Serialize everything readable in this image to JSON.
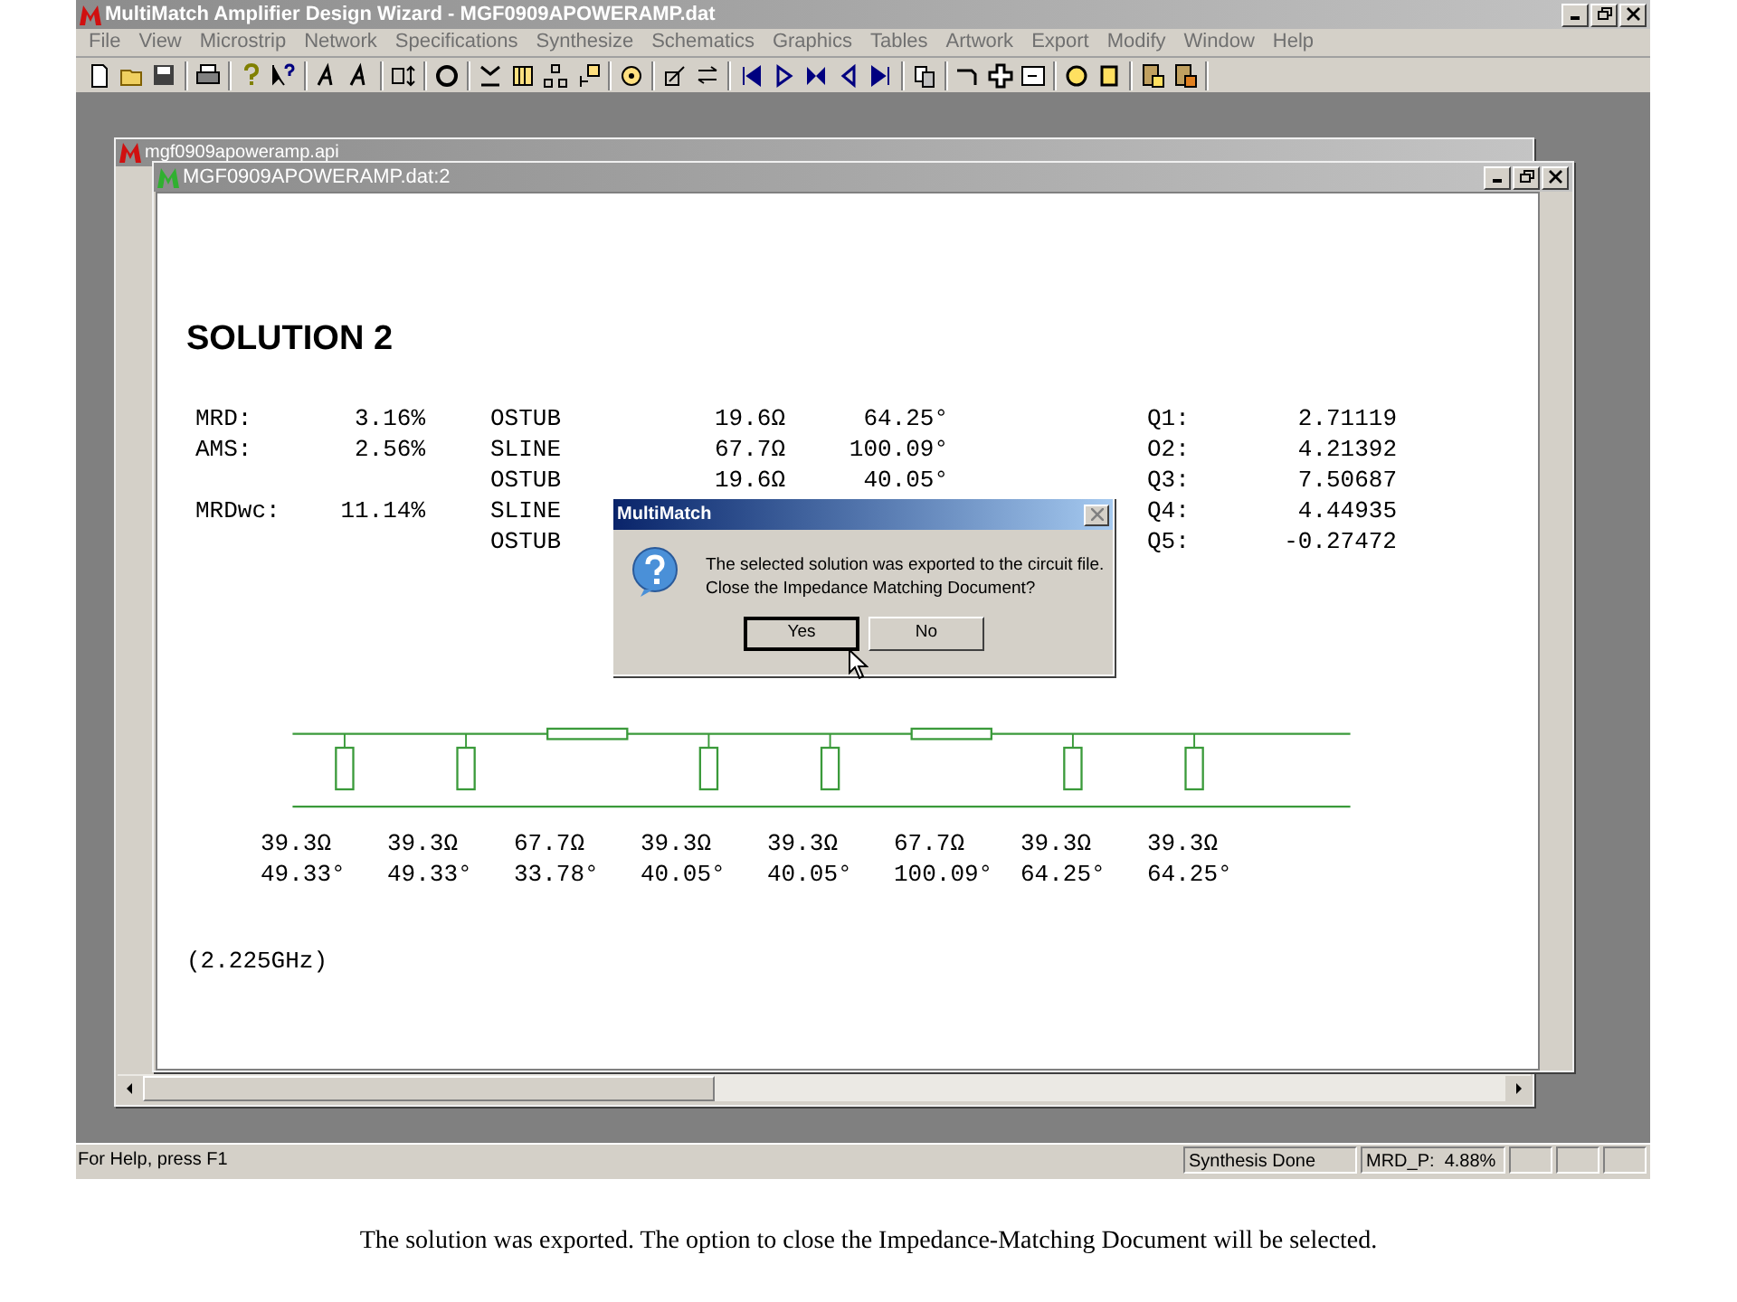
{
  "window": {
    "title": "MultiMatch Amplifier Design Wizard - MGF0909APOWERAMP.dat"
  },
  "menu": [
    "File",
    "View",
    "Microstrip",
    "Network",
    "Specifications",
    "Synthesize",
    "Schematics",
    "Graphics",
    "Tables",
    "Artwork",
    "Export",
    "Modify",
    "Window",
    "Help"
  ],
  "documents": [
    {
      "title": "mgf0909apoweramp.api"
    },
    {
      "title": "MGF0909APOWERAMP.dat:2"
    }
  ],
  "solution": {
    "heading": "SOLUTION 2",
    "rows": [
      {
        "metric": {
          "label": "MRD:",
          "value": "3.16%"
        },
        "element": {
          "type": "OSTUB",
          "impedance": "19.6Ω",
          "angle": "64.25°"
        },
        "q": {
          "label": "Q1:",
          "value": "2.71119"
        }
      },
      {
        "metric": {
          "label": "AMS:",
          "value": "2.56%"
        },
        "element": {
          "type": "SLINE",
          "impedance": "67.7Ω",
          "angle": "100.09°"
        },
        "q": {
          "label": "O2:",
          "value": "4.21392"
        }
      },
      {
        "element": {
          "type": "OSTUB",
          "impedance": "19.6Ω",
          "angle": "40.05°"
        },
        "q": {
          "label": "Q3:",
          "value": "7.50687"
        }
      },
      {
        "metric": {
          "label": "MRDwc:",
          "value": "11.14%"
        },
        "element": {
          "type": "SLINE"
        },
        "q": {
          "label": "Q4:",
          "value": "4.44935"
        }
      },
      {
        "element": {
          "type": "OSTUB"
        },
        "q": {
          "label": "Q5:",
          "value": "-0.27472"
        }
      }
    ]
  },
  "circuit": {
    "elements": [
      {
        "kind": "stub",
        "impedance": "39.3Ω",
        "angle": "49.33°"
      },
      {
        "kind": "stub",
        "impedance": "39.3Ω",
        "angle": "49.33°"
      },
      {
        "kind": "line",
        "impedance": "67.7Ω",
        "angle": "33.78°"
      },
      {
        "kind": "stub",
        "impedance": "39.3Ω",
        "angle": "40.05°"
      },
      {
        "kind": "stub",
        "impedance": "39.3Ω",
        "angle": "40.05°"
      },
      {
        "kind": "line",
        "impedance": "67.7Ω",
        "angle": "100.09°"
      },
      {
        "kind": "stub",
        "impedance": "39.3Ω",
        "angle": "64.25°"
      },
      {
        "kind": "stub",
        "impedance": "39.3Ω",
        "angle": "64.25°"
      }
    ],
    "frequency": "(2.225GHz)"
  },
  "dialog": {
    "title": "MultiMatch",
    "message": "The selected solution was exported to the circuit file.\nClose the Impedance Matching Document?",
    "buttons": [
      {
        "label": "Yes",
        "selected": true
      },
      {
        "label": "No",
        "selected": false
      }
    ]
  },
  "status_bar": {
    "help": "For Help, press F1",
    "panels": [
      "Synthesis Done",
      "MRD_P:  4.88%"
    ]
  },
  "caption": "The solution was exported. The option to close the Impedance-Matching Document will be selected."
}
